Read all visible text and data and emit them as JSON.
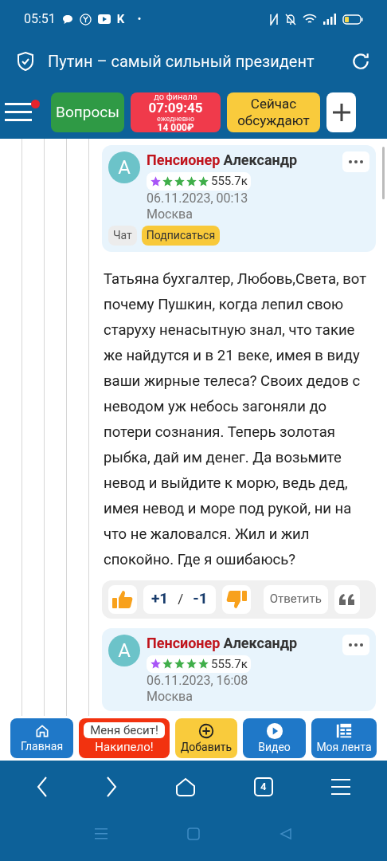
{
  "status_bar": {
    "time": "05:51",
    "notif_letter": "K",
    "dot": "•"
  },
  "address_bar": {
    "title": "Путин – самый сильный президент"
  },
  "top_nav": {
    "questions": "Вопросы",
    "timer": {
      "top": "до финала",
      "time": "07:09:45",
      "bottom": "ежедневно",
      "prize": "14 000₽"
    },
    "discussing": [
      "Сейчас",
      "обсуждают"
    ],
    "has_notification": true
  },
  "comments": [
    {
      "rank": "Пенсионер",
      "name": "Александр",
      "score": "555.7к",
      "date": "06.11.2023, 00:13",
      "city": "Москва",
      "avatar": "A",
      "chat": "Чат",
      "subscribe": "Подписаться",
      "text": "Татьяна бухгалтер, Любовь,Света, вот почему Пушкин, когда лепил свою старуху ненасытную знал, что такие же найдутся и в 21 веке, имея в виду ваши жирные телеса? Своих дедов с неводом уж небось загоняли до потери сознания. Теперь золотая рыбка, дай им денег. Да возьмите невод и выйдите к морю, ведь дед, имея невод и море под рукой, ни на что не жаловался. Жил и жил спокойно. Где я ошибаюсь?",
      "votes": {
        "plus": "+1",
        "sep": "/",
        "minus": "-1"
      },
      "reply": "Ответить"
    },
    {
      "rank": "Пенсионер",
      "name": "Александр",
      "score": "555.7к",
      "date": "06.11.2023, 16:08",
      "city": "Москва",
      "avatar": "A"
    }
  ],
  "bottom_bar": [
    {
      "kind": "home",
      "label": "Главная"
    },
    {
      "kind": "rant",
      "top": "Меня бесит!",
      "label": "Накипело!"
    },
    {
      "kind": "add",
      "label": "Добавить"
    },
    {
      "kind": "video",
      "label": "Видео"
    },
    {
      "kind": "feed",
      "label": "Моя лента"
    }
  ],
  "browser_nav": {
    "tabs_count": "4"
  }
}
